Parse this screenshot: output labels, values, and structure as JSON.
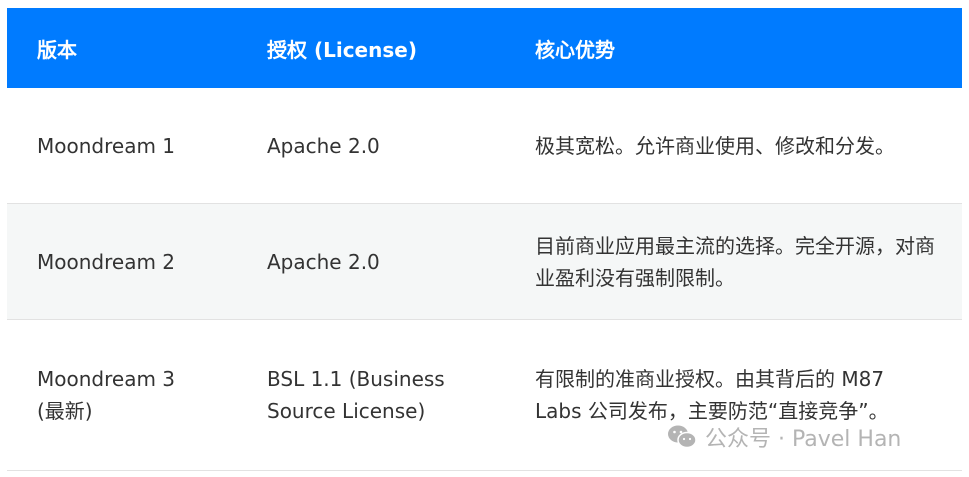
{
  "header": {
    "version": "版本",
    "license": "授权 (License)",
    "advantage": "核心优势"
  },
  "rows": [
    {
      "version": "Moondream 1",
      "license": "Apache 2.0",
      "advantage": "极其宽松。允许商业使用、修改和分发。"
    },
    {
      "version": "Moondream 2",
      "license": "Apache 2.0",
      "advantage": "目前商业应用最主流的选择。完全开源，对商业盈利没有强制限制。"
    },
    {
      "version": "Moondream 3 (最新)",
      "license": "BSL 1.1 (Business Source License)",
      "advantage": "有限制的准商业授权。由其背后的 M87 Labs 公司发布，主要防范“直接竞争”。"
    }
  ],
  "watermark": "公众号 · Pavel Han",
  "colors": {
    "header_bg": "#007bff",
    "alt_row_bg": "#f5f7f7"
  }
}
